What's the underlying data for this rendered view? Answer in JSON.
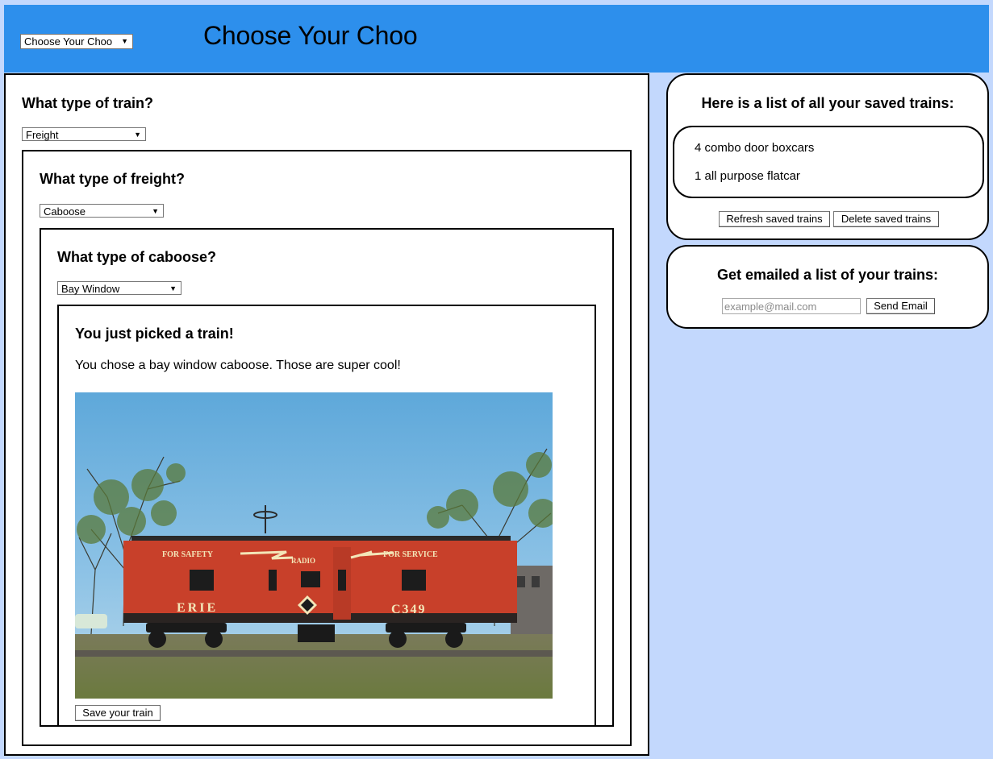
{
  "header": {
    "nav_selected": "Choose Your Choo",
    "title": "Choose Your Choo"
  },
  "step1": {
    "question": "What type of train?",
    "selected": "Freight"
  },
  "step2": {
    "question": "What type of freight?",
    "selected": "Caboose"
  },
  "step3": {
    "question": "What type of caboose?",
    "selected": "Bay Window"
  },
  "result": {
    "heading": "You just picked a train!",
    "message": "You chose a bay window caboose. Those are super cool!",
    "save_label": "Save your train",
    "photo_lettering": {
      "left_slogan": "FOR SAFETY",
      "center": "RADIO",
      "right_slogan": "FOR SERVICE",
      "road_name": "ERIE",
      "car_number": "C349"
    }
  },
  "saved": {
    "title": "Here is a list of all your saved trains:",
    "items": [
      "4 combo door boxcars",
      "1 all purpose flatcar"
    ],
    "refresh_label": "Refresh saved trains",
    "delete_label": "Delete saved trains"
  },
  "email": {
    "title": "Get emailed a list of your trains:",
    "placeholder": "example@mail.com",
    "send_label": "Send Email"
  },
  "colors": {
    "header_bg": "#2d8fec",
    "page_bg": "#c3d8fd",
    "caboose_red": "#c8402a"
  }
}
